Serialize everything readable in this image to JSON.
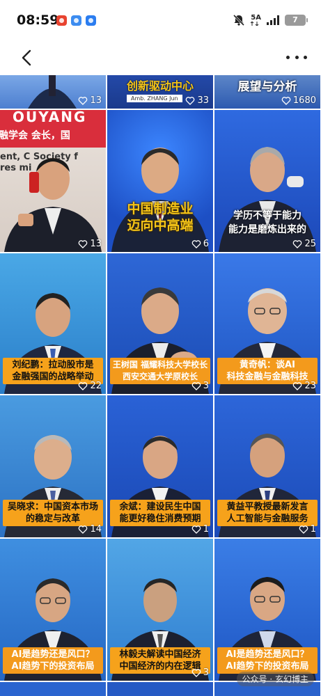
{
  "status_bar": {
    "time": "08:59",
    "network": "5A",
    "battery": "7",
    "icons": [
      "video-app-icon",
      "bulb-app-icon",
      "fingerprint-app-icon",
      "mute-bell-icon",
      "signal-icon",
      "battery-icon"
    ]
  },
  "nav": {
    "back_icon": "chevron-left-icon",
    "more_icon": "more-dots-icon"
  },
  "tiles": [
    {
      "likes": "13"
    },
    {
      "top_text": "创新驱动中心",
      "sub_text": "Amb. ZHANG Jun",
      "likes": "33"
    },
    {
      "top_text": "展望与分析",
      "likes": "1680"
    },
    {
      "banner_name": "OUYANG",
      "banner_line1": "融学会   会长，国",
      "banner_line2": "ent, C   Society f",
      "banner_line3": "res   mi",
      "likes": "13"
    },
    {
      "title": "中国制造业\n迈向中高端",
      "likes": "6"
    },
    {
      "title": "学历不等于能力\n能力是磨炼出来的",
      "likes": "25"
    },
    {
      "caption": "刘纪鹏：拉动股市是\n金融强国的战略举动",
      "likes": "22"
    },
    {
      "caption": "王树国  福耀科技大学校长\n西安交通大学原校长",
      "likes": "3"
    },
    {
      "caption": "黄奇帆：谈AI\n科技金融与金融科技",
      "likes": "23"
    },
    {
      "caption": "吴晓求：中国资本市场\n的稳定与改革",
      "likes": "14"
    },
    {
      "caption": "余斌：建设民生中国\n能更好稳住消费预期",
      "likes": "1"
    },
    {
      "caption": "黄益平教授最新发言\n人工智能与金融服务",
      "likes": "1"
    },
    {
      "caption": "AI是趋势还是风口？\nAI趋势下的投资布局",
      "likes": ""
    },
    {
      "caption": "林毅夫解读中国经济\n中国经济的内在逻辑",
      "likes": "3"
    },
    {
      "caption": "AI是趋势还是风口？\nAI趋势下的投资布局",
      "likes": ""
    }
  ],
  "watermark": "公众号 · 玄幻博主",
  "colors": {
    "caption_orange": "#f6a21b",
    "title_yellow": "#f5c518",
    "stage_blue": "#1f57c9"
  }
}
